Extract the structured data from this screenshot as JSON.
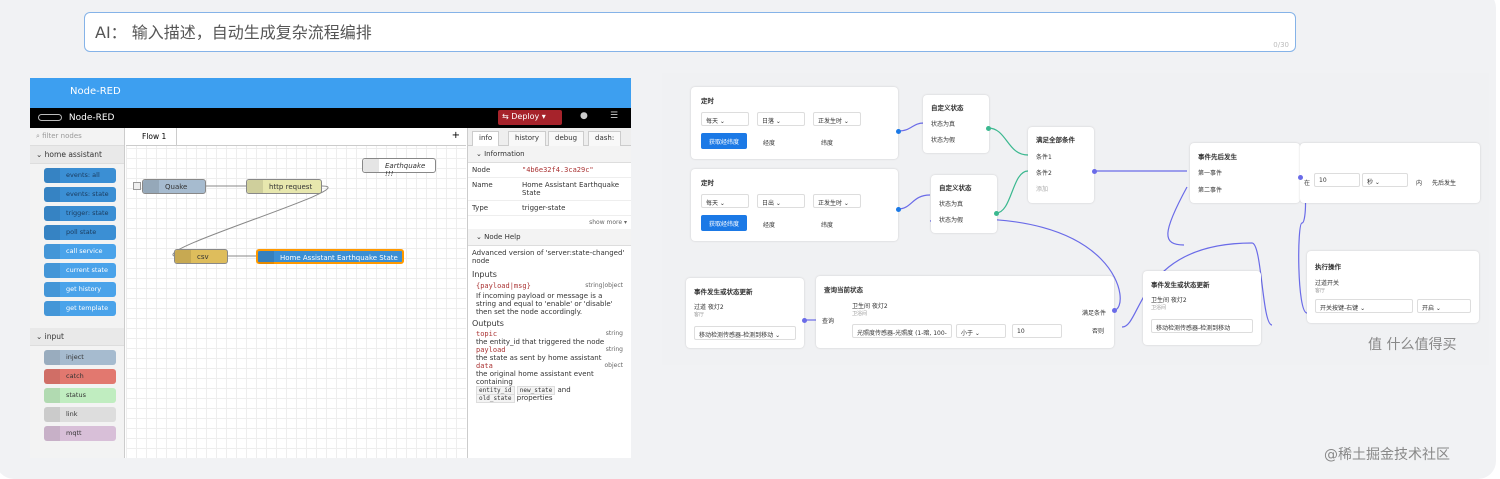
{
  "ai_input": {
    "text": "AI： 输入描述，自动生成复杂流程编排",
    "counter": "0/30"
  },
  "nodered": {
    "brand": "Node-RED",
    "deploy": "Deploy",
    "filter": "filter nodes",
    "categories": [
      "home assistant",
      "input"
    ],
    "ha_nodes": [
      "events: all",
      "events: state",
      "trigger: state",
      "poll state",
      "call service",
      "current state",
      "get history",
      "get template"
    ],
    "input_nodes": [
      "inject",
      "catch",
      "status",
      "link",
      "mqtt"
    ],
    "flow_tab": "Flow 1",
    "flow_nodes": {
      "quake": "Quake",
      "http": "http request",
      "earthquake": "Earthquake !!!",
      "csv": "csv",
      "ha": "Home Assistant Earthquake State"
    },
    "sidebar": {
      "tabs": [
        "info",
        "history",
        "debug",
        "dash: "
      ],
      "info_title": "Information",
      "info": [
        {
          "k": "Node",
          "v": "\"4b6e32f4.3ca29c\""
        },
        {
          "k": "Name",
          "v": "Home Assistant Earthquake State"
        },
        {
          "k": "Type",
          "v": "trigger-state"
        }
      ],
      "show_more": "show more ▾",
      "help_title": "Node Help",
      "help_desc": "Advanced version of 'server:state-changed' node",
      "inputs_title": "Inputs",
      "input_sig": "{payload|msg}",
      "input_type": "string|object",
      "input_desc": "If incoming payload or message is a string and equal to 'enable' or 'disable' then set the node accordingly.",
      "outputs_title": "Outputs",
      "outputs": [
        {
          "name": "topic",
          "type": "string",
          "desc": "the entity_id that triggered the node"
        },
        {
          "name": "payload",
          "type": "string",
          "desc": "the state as sent by home assistant"
        },
        {
          "name": "data",
          "type": "object",
          "desc": "the original home assistant event containing"
        }
      ],
      "codes": [
        "entity_id",
        "new_state",
        "old_state"
      ],
      "and": "and",
      "props": "properties"
    }
  },
  "flow2": {
    "timer1": {
      "title": "定时",
      "d1": "每天",
      "d2": "日落",
      "d3": "正发生时",
      "btn": "获取经纬度",
      "lng": "经度",
      "lat": "纬度"
    },
    "timer2": {
      "title": "定时",
      "d1": "每天",
      "d2": "日出",
      "d3": "正发生时",
      "btn": "获取经纬度",
      "lng": "经度",
      "lat": "纬度"
    },
    "custom1": {
      "title": "自定义状态",
      "a": "状态为真",
      "b": "状态为假"
    },
    "custom2": {
      "title": "自定义状态",
      "a": "状态为真",
      "b": "状态为假"
    },
    "all": {
      "title": "满足全部条件",
      "a": "条件1",
      "b": "条件2",
      "c": "添加"
    },
    "seq": {
      "title": "事件先后发生",
      "a": "第一事件",
      "b": "第二事件",
      "in": "在",
      "num": "10",
      "unit": "秒",
      "within": "内",
      "first": "先后发生"
    },
    "ev1": {
      "title": "事件发生或状态更新",
      "sub": "过道 夜灯2",
      "sub2": "客厅",
      "dd": "移动检测传感器-检测到移动"
    },
    "query": {
      "title": "查询当前状态",
      "sub": "卫生间 夜灯2",
      "sub2": "卫浴间",
      "dd1": "光照度传感器-光照度 (1-暗, 100-",
      "dd2": "小于",
      "val": "10",
      "q": "查询",
      "ok": "满足条件",
      "no": "否则"
    },
    "ev2": {
      "title": "事件发生或状态更新",
      "sub": "卫生间 夜灯2",
      "sub2": "卫浴间",
      "dd": "移动检测传感器-检测到移动"
    },
    "act": {
      "title": "执行操作",
      "sub": "过道开关",
      "sub2": "客厅",
      "dd1": "开关按键-右键",
      "dd2": "开启"
    }
  },
  "watermarks": {
    "w1": "值 什么值得买",
    "w2": "@稀土掘金技术社区"
  }
}
